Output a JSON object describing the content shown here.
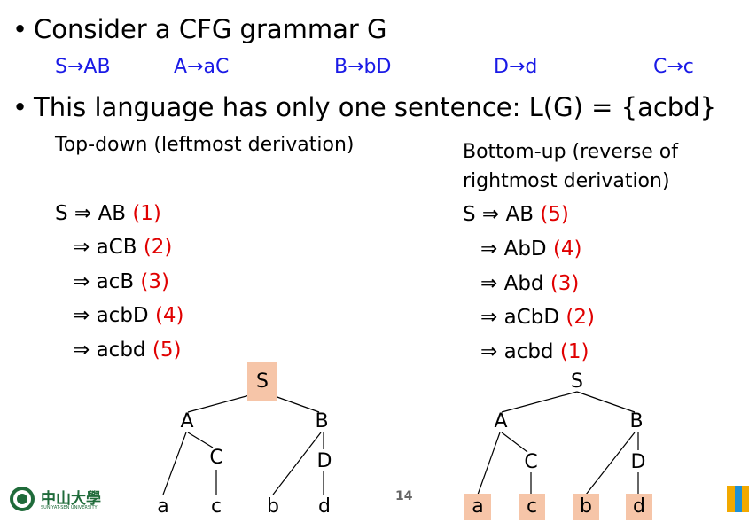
{
  "bullets": {
    "b1": "Consider a CFG grammar G",
    "b2": "This language has only one sentence: L(G) = {acbd}"
  },
  "rules": [
    "S→AB",
    "A→aC",
    "B→bD",
    "D→d",
    "C→c"
  ],
  "topdown": {
    "heading": "Top-down (leftmost derivation)",
    "steps": [
      {
        "text": "S ⇒ AB",
        "num": "(1)"
      },
      {
        "text": "⇒ aCB",
        "num": "(2)"
      },
      {
        "text": "⇒ acB",
        "num": "(3)"
      },
      {
        "text": "⇒ acbD",
        "num": "(4)"
      },
      {
        "text": "⇒ acbd",
        "num": "(5)"
      }
    ]
  },
  "bottomup": {
    "heading1": "Bottom-up (reverse of",
    "heading2": "rightmost derivation)",
    "steps": [
      {
        "text": "S ⇒ AB",
        "num": "(5)"
      },
      {
        "text": "⇒ AbD",
        "num": "(4)"
      },
      {
        "text": "⇒ Abd",
        "num": "(3)"
      },
      {
        "text": "⇒ aCbD",
        "num": "(2)"
      },
      {
        "text": "⇒ acbd",
        "num": "(1)"
      }
    ]
  },
  "tree_labels": {
    "S": "S",
    "A": "A",
    "B": "B",
    "C": "C",
    "D": "D",
    "a": "a",
    "c": "c",
    "b": "b",
    "d": "d"
  },
  "footer": {
    "page_number": "14",
    "logo_cn": "中山大學",
    "logo_en": "SUN YAT-SEN UNIVERSITY"
  },
  "colors": {
    "rule_blue": "#1a1ae6",
    "step_red": "#e00000",
    "highlight": "#f6c5a8"
  }
}
